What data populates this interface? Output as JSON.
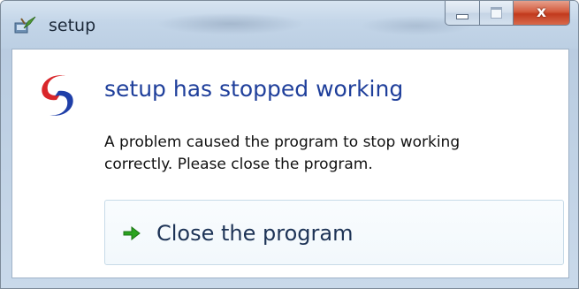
{
  "window": {
    "title": "setup",
    "controls": {
      "minimize_icon": "minimize-icon",
      "maximize_icon": "maximize-icon",
      "close_symbol": "x"
    }
  },
  "dialog": {
    "heading": "setup has stopped working",
    "message": "A problem caused the program to stop working correctly. Please close the program.",
    "action": {
      "label": "Close the program",
      "icon": "green-arrow-icon"
    }
  },
  "colors": {
    "heading": "#1f3f9b",
    "arrow": "#2aa31f",
    "close_button": "#c23a1d"
  }
}
